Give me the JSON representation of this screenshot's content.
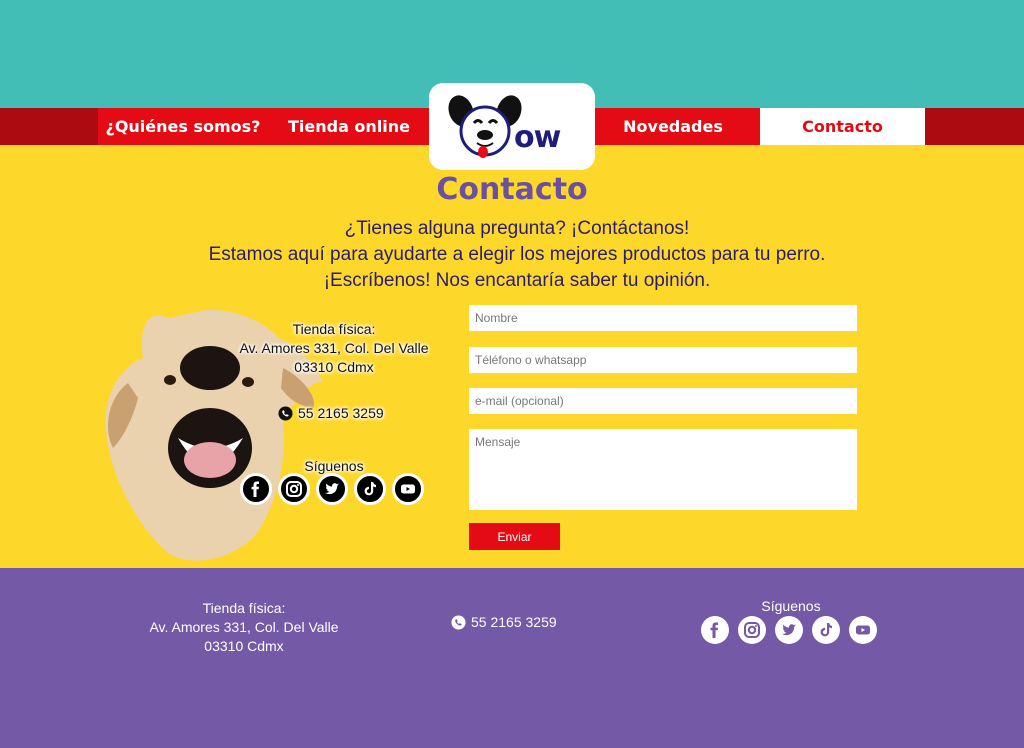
{
  "nav": {
    "items": [
      {
        "label": "¿Quiénes somos?"
      },
      {
        "label": "Tienda online"
      },
      {
        "label": "Novedades"
      },
      {
        "label": "Contacto"
      }
    ]
  },
  "logo": {
    "text": "ow"
  },
  "page": {
    "title": "Contacto",
    "intro": [
      "¿Tienes alguna pregunta? ¡Contáctanos!",
      "Estamos aquí para ayudarte a elegir los mejores productos para tu perro.",
      "¡Escríbenos! Nos encantaría saber tu opinión."
    ]
  },
  "store": {
    "heading": "Tienda física:",
    "address_line1": "Av. Amores 331, Col. Del Valle",
    "address_line2": "03310 Cdmx"
  },
  "phone": "55 2165 3259",
  "social": {
    "heading": "Síguenos",
    "icons": [
      "facebook-icon",
      "instagram-icon",
      "twitter-icon",
      "tiktok-icon",
      "youtube-icon"
    ]
  },
  "form": {
    "name_placeholder": "Nombre",
    "phone_placeholder": "Téléfono o whatsapp",
    "email_placeholder": "e-mail (opcional)",
    "message_placeholder": "Mensaje",
    "submit_label": "Enviar"
  },
  "colors": {
    "teal": "#42beb6",
    "red": "#e50b14",
    "yellow": "#fdd82b",
    "purple": "#7359a6"
  }
}
